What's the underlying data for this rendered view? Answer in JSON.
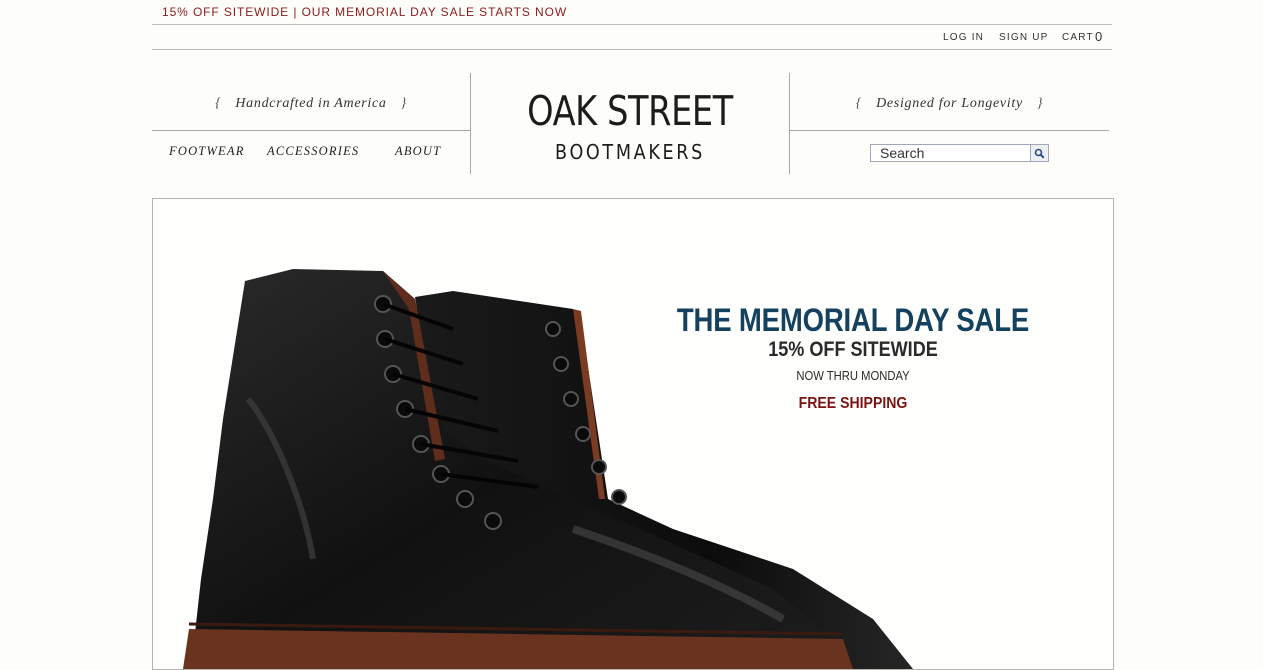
{
  "promo_bar": {
    "text": "15% OFF SITEWIDE | OUR MEMORIAL DAY SALE STARTS NOW",
    "color": "#8a1c1c"
  },
  "account": {
    "login": "LOG IN",
    "signup": "SIGN UP",
    "cart_label": "CART",
    "cart_count": "0"
  },
  "header": {
    "left_tagline": "Handcrafted in America",
    "right_tagline": "Designed for Longevity",
    "bracket_open": "{",
    "bracket_close": "}",
    "logo_line1": "OAK STREET",
    "logo_line2": "BOOTMAKERS"
  },
  "nav": {
    "items": [
      {
        "label": "FOOTWEAR"
      },
      {
        "label": "ACCESSORIES"
      },
      {
        "label": "ABOUT"
      }
    ]
  },
  "search": {
    "value": "Search",
    "icon": "magnifier-icon"
  },
  "hero": {
    "headline": "THE MEMORIAL DAY SALE",
    "subhead": "15% OFF SITEWIDE",
    "dates": "NOW THRU MONDAY",
    "offer": "FREE SHIPPING",
    "headline_color": "#13415e",
    "offer_color": "#7c1414",
    "image": "black-leather-boots-image"
  }
}
